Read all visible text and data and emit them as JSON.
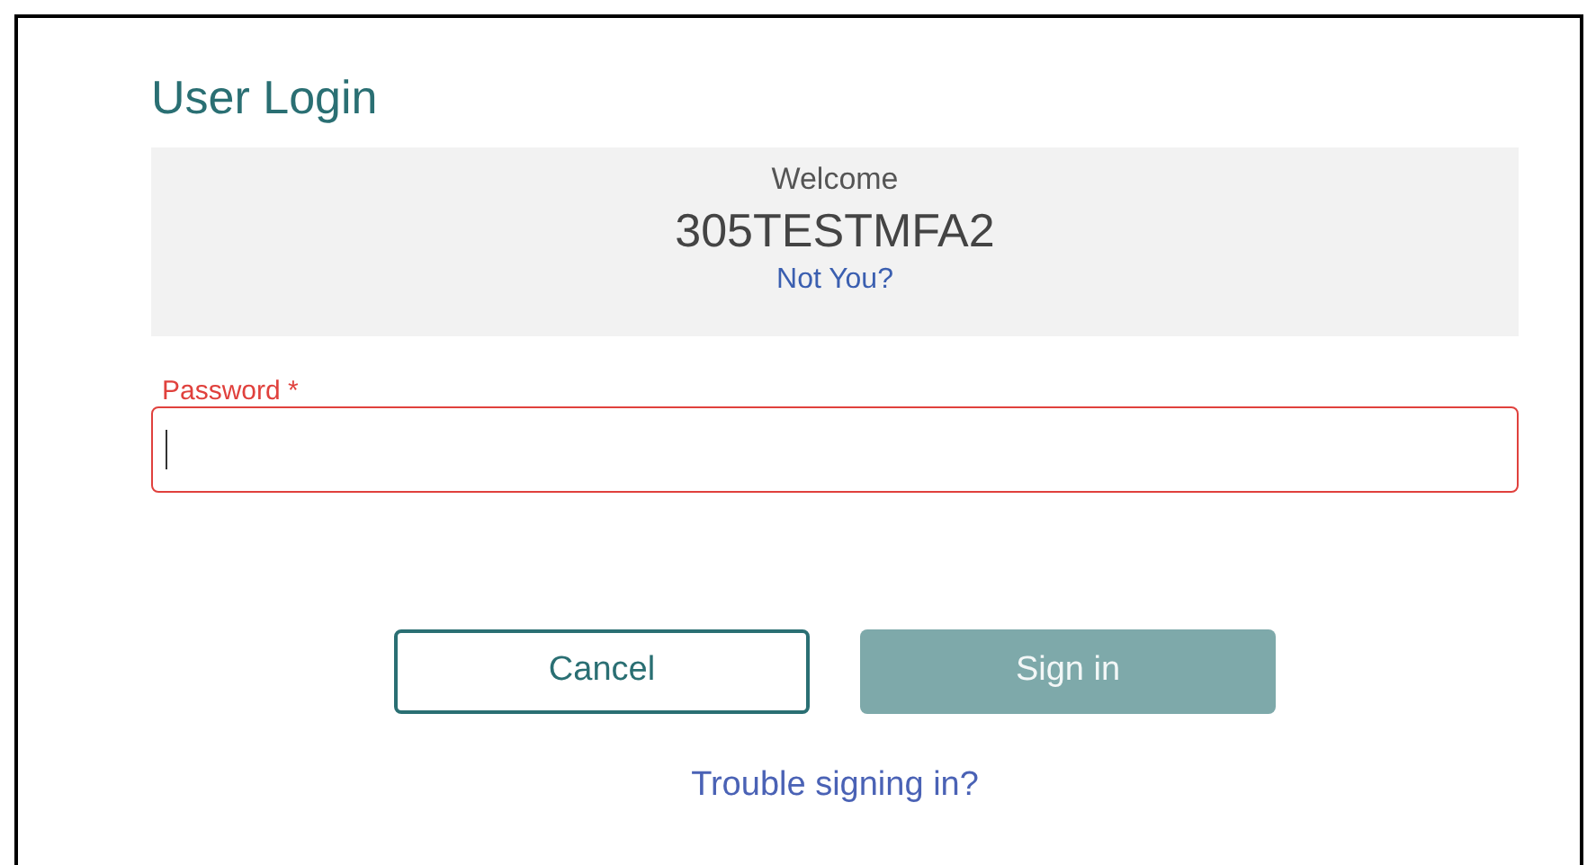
{
  "title": "User Login",
  "welcome": {
    "greeting": "Welcome",
    "username": "305TESTMFA2",
    "not_you_link": "Not You?"
  },
  "password": {
    "label": "Password *",
    "invalid": true,
    "focused": true
  },
  "buttons": [
    {
      "label": "Cancel",
      "kind": "secondary",
      "disabled": false
    },
    {
      "label": "Sign in",
      "kind": "primary",
      "disabled": true
    }
  ],
  "help_link": "Trouble signing in?"
}
